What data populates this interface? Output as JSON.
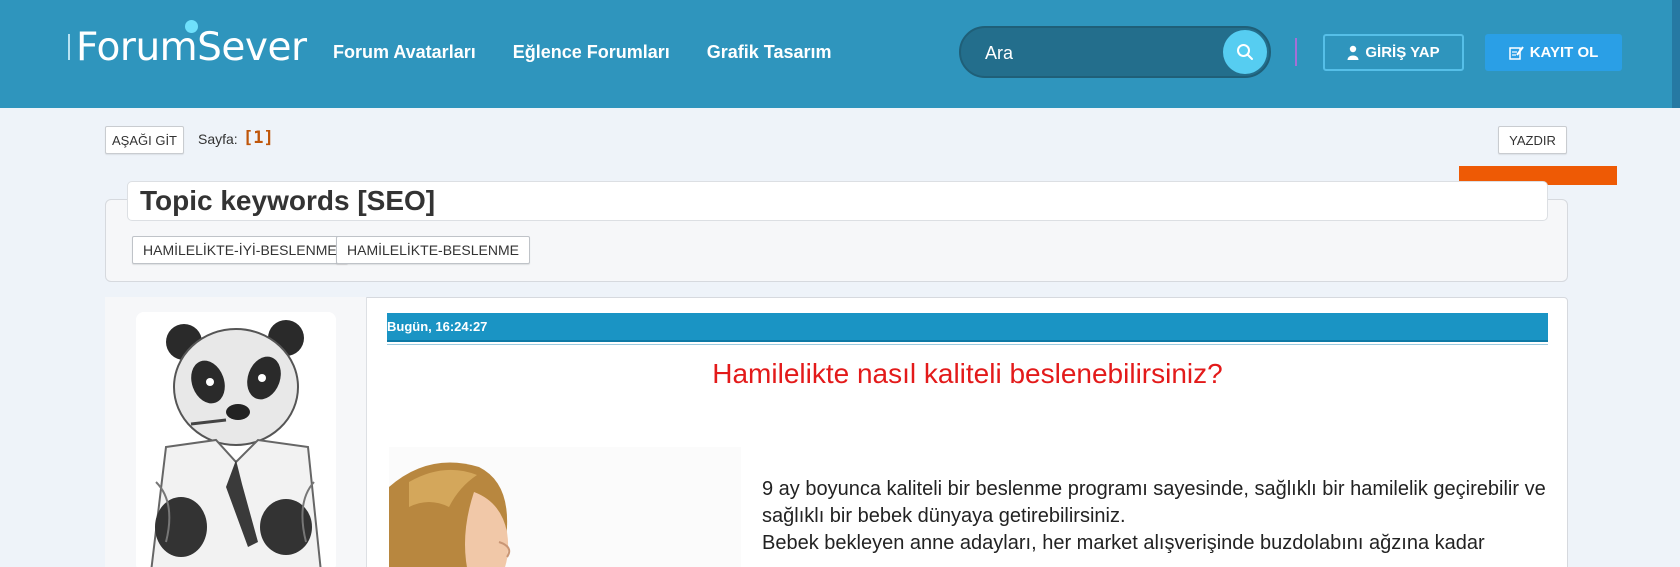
{
  "header": {
    "logo": "ForumSever",
    "nav": [
      "Forum Avatarları",
      "Eğlence Forumları",
      "Grafik Tasarım"
    ],
    "search_placeholder": "Ara",
    "login_label": "GİRİŞ YAP",
    "register_label": "KAYIT OL"
  },
  "toolbar": {
    "down_label": "AŞAĞI GİT",
    "page_label": "Sayfa:",
    "page_number": "[1]",
    "print_label": "YAZDIR"
  },
  "keywords": {
    "title": "Topic keywords [SEO]",
    "tags": [
      "HAMİLELİKTE-İYİ-BESLENME",
      "HAMİLELİKTE-BESLENME"
    ]
  },
  "post": {
    "date": "Bugün, 16:24:27",
    "title": "Hamilelikte nasıl kaliteli beslenebilirsiniz?",
    "paragraphs": [
      "9 ay boyunca kaliteli bir beslenme programı sayesinde, sağlıklı bir hamilelik geçirebilir ve sağlıklı bir bebek dünyaya getirebilirsiniz.",
      "Bebek bekleyen anne adayları, her market alışverişinde buzdolabını ağzına kadar"
    ]
  },
  "colors": {
    "header_bg": "#2f95bd",
    "accent_orange": "#ee5a05",
    "title_red": "#e31a1a",
    "date_bar": "#1a94c4"
  }
}
